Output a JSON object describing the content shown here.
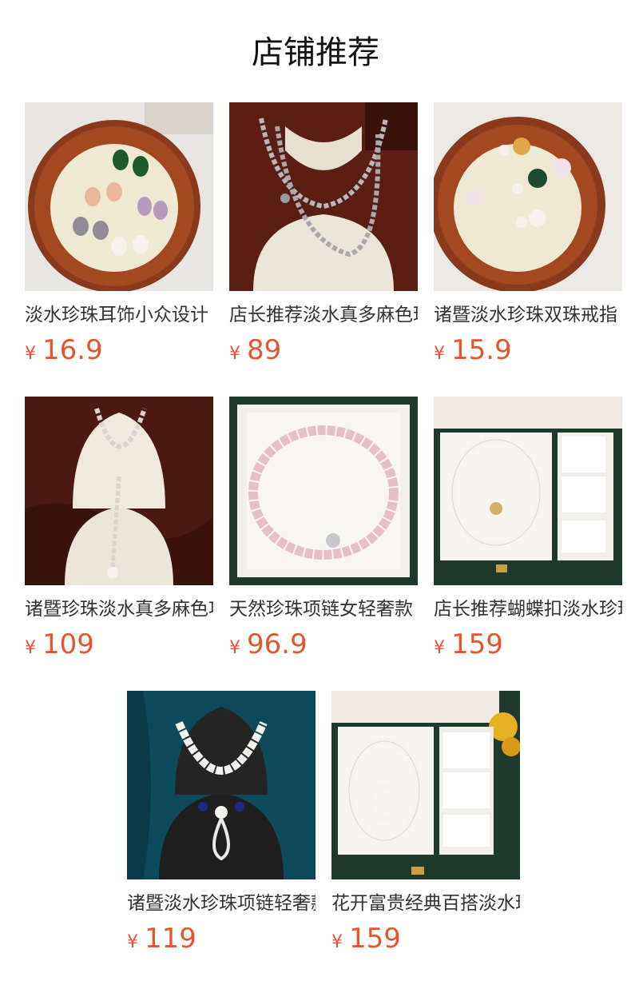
{
  "page": {
    "title": "店铺推荐"
  },
  "colors": {
    "price": "#e4572e",
    "title": "#111111",
    "text": "#333333"
  },
  "products": [
    {
      "name": "淡水珍珠耳饰小众设计",
      "currency": "¥",
      "price": "16.9",
      "image": "pearl-earrings-tray"
    },
    {
      "name": "店长推荐淡水真多麻色珍珠",
      "currency": "¥",
      "price": "89",
      "image": "grey-pearl-long-necklace"
    },
    {
      "name": "诸暨淡水珍珠双珠戒指",
      "currency": "¥",
      "price": "15.9",
      "image": "pearl-rings-tray"
    },
    {
      "name": "诸暨珍珠淡水真多麻色项链",
      "currency": "¥",
      "price": "109",
      "image": "y-pearl-necklace"
    },
    {
      "name": "天然珍珠项链女轻奢款",
      "currency": "¥",
      "price": "96.9",
      "image": "pink-pearl-necklace-box"
    },
    {
      "name": "店长推荐蝴蝶扣淡水珍珠套装",
      "currency": "¥",
      "price": "159",
      "image": "butterfly-pearl-set-box"
    },
    {
      "name": "诸暨淡水珍珠项链轻奢款",
      "currency": "¥",
      "price": "119",
      "image": "sapphire-pearl-necklace"
    },
    {
      "name": "花开富贵经典百搭淡水珍珠",
      "currency": "¥",
      "price": "159",
      "image": "flower-pearl-set-box"
    }
  ]
}
